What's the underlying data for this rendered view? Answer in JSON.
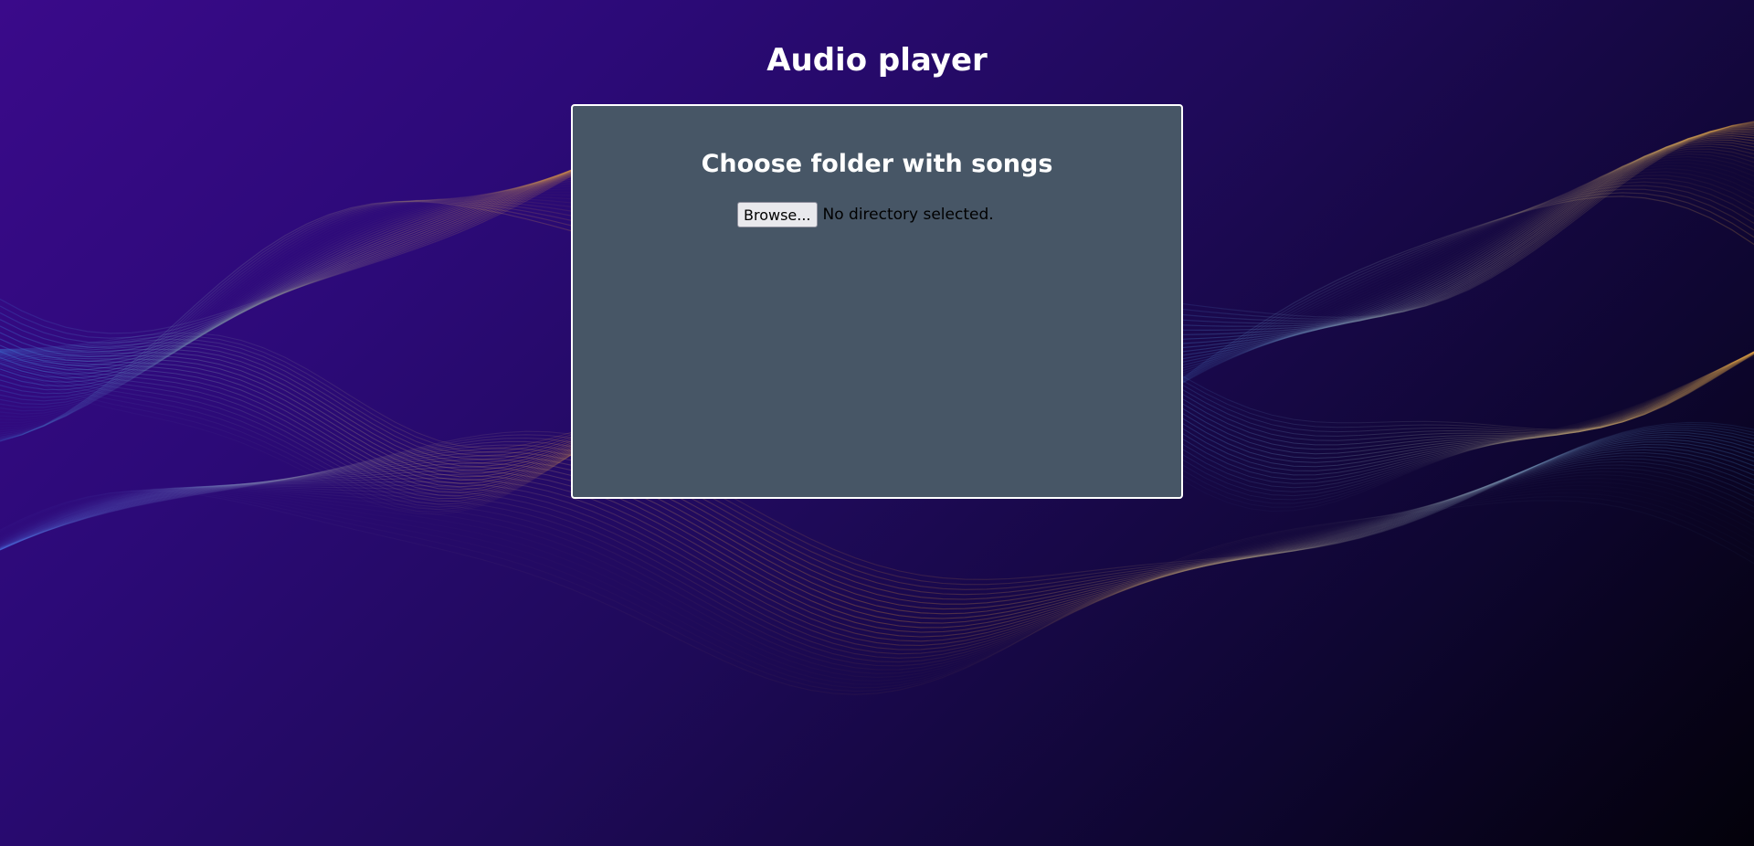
{
  "page": {
    "title": "Audio player"
  },
  "panel": {
    "heading": "Choose folder with songs",
    "browse_label": "Browse...",
    "status_text": "No directory selected."
  },
  "colors": {
    "background_primary": "#2c0a78",
    "background_dark": "#03010a",
    "panel_background": "#475666",
    "panel_border": "#ffffff",
    "title_text": "#ffffff"
  }
}
